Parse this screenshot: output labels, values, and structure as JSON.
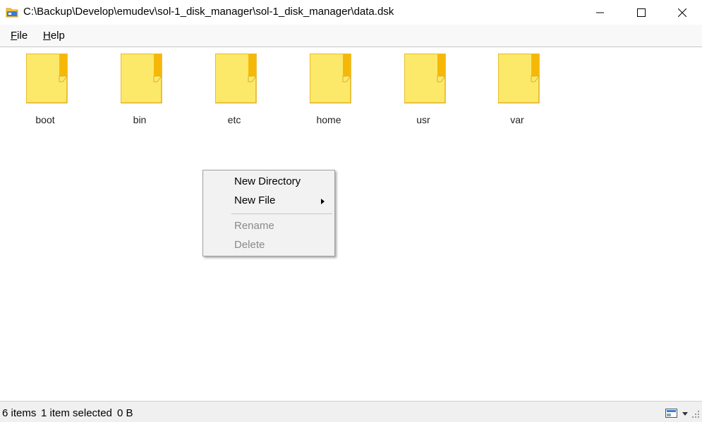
{
  "window": {
    "title": "C:\\Backup\\Develop\\emudev\\sol-1_disk_manager\\sol-1_disk_manager\\data.dsk",
    "icon": "folder-app-icon"
  },
  "menubar": {
    "file_first": "F",
    "file_rest": "ile",
    "help_first": "H",
    "help_rest": "elp"
  },
  "folders": [
    {
      "name": "boot"
    },
    {
      "name": "bin"
    },
    {
      "name": "etc"
    },
    {
      "name": "home"
    },
    {
      "name": "usr"
    },
    {
      "name": "var"
    }
  ],
  "context_menu": {
    "new_directory": "New Directory",
    "new_file": "New File",
    "rename": "Rename",
    "delete": "Delete"
  },
  "status": {
    "items": "6 items",
    "selected": "1 item selected",
    "size": "0 B"
  },
  "colors": {
    "folder_body": "#fce96a",
    "folder_tab": "#f6b808",
    "folder_edge": "#e0b020"
  }
}
